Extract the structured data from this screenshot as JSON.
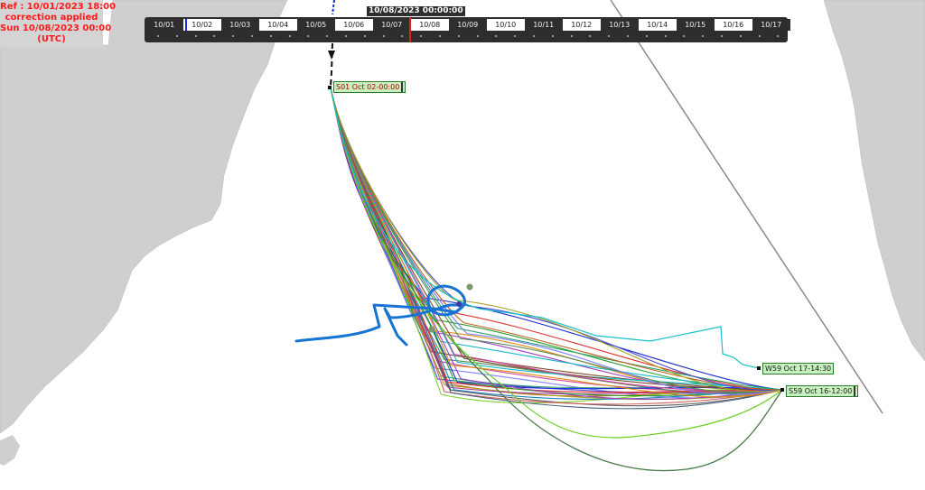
{
  "reference": {
    "line1": "Ref : 10/01/2023 18:00",
    "line2": "correction applied",
    "line3": "Sun 10/08/2023 00:00",
    "line4": "(UTC)"
  },
  "timeline": {
    "current_time": "10/08/2023 00:00:00",
    "dates": [
      "10/01",
      "10/02",
      "10/03",
      "10/04",
      "10/05",
      "10/06",
      "10/07",
      "10/08",
      "10/09",
      "10/10",
      "10/11",
      "10/12",
      "10/13",
      "10/14",
      "10/15",
      "10/16",
      "10/17"
    ]
  },
  "markers": {
    "start": "S01 Oct 02-00:00",
    "west": "W59 Oct 17-14:30",
    "end": "S59 Oct 16-12:00"
  },
  "colors": {
    "land": "#cfcfcf",
    "current_track": "#1573d4",
    "tag_bg": "#c8f0c0",
    "ref_text": "#ff1a1a"
  }
}
